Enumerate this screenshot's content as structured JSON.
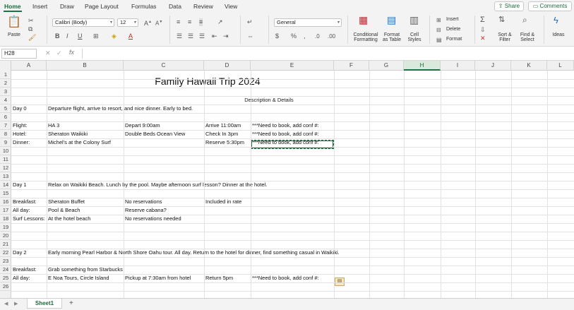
{
  "tabs": [
    "Home",
    "Insert",
    "Draw",
    "Page Layout",
    "Formulas",
    "Data",
    "Review",
    "View"
  ],
  "share_label": "Share",
  "comments_label": "Comments",
  "ribbon": {
    "paste": "Paste",
    "font_name": "Calibri (Body)",
    "font_size": "12",
    "number_format": "General",
    "conditional_formatting": [
      "Conditional",
      "Formatting"
    ],
    "format_as_table": [
      "Format",
      "as Table"
    ],
    "cell_styles": [
      "Cell",
      "Styles"
    ],
    "insert": "Insert",
    "delete": "Delete",
    "format": "Format",
    "sort_filter": [
      "Sort &",
      "Filter"
    ],
    "find_select": [
      "Find &",
      "Select"
    ],
    "ideas": "Ideas"
  },
  "formula_bar": {
    "name_box": "H28",
    "fx": "fx"
  },
  "columns": [
    "A",
    "B",
    "C",
    "D",
    "E",
    "F",
    "G",
    "H",
    "I",
    "J",
    "K",
    "L"
  ],
  "selected_column": "H",
  "rows": [
    "1",
    "2",
    "3",
    "4",
    "5",
    "6",
    "7",
    "8",
    "9",
    "10",
    "11",
    "12",
    "13",
    "14",
    "15",
    "16",
    "17",
    "18",
    "19",
    "20",
    "21",
    "22",
    "23",
    "24",
    "25",
    "26"
  ],
  "sheet": {
    "title": "Family Hawaii Trip 2024",
    "desc_header": "Description & Details",
    "r5": {
      "a": "Day 0",
      "b": "Departure flight, arrive to resort, and nice dinner. Early to bed."
    },
    "r7": {
      "a": "Flight:",
      "b": "HA 3",
      "c": "Depart 9:00am",
      "d": "Arrive 11:00am",
      "e": "***Need to book, add conf #:"
    },
    "r8": {
      "a": "Hotel:",
      "b": "Sheraton Waikiki",
      "c": "Double Beds Ocean View",
      "d": "Check In 3pm",
      "e": "***Need to book, add conf #:"
    },
    "r9": {
      "a": "Dinner:",
      "b": "Michel's at the Colony Surf",
      "d": "Reserve 5:30pm",
      "e": "***Need to book, add conf #:"
    },
    "r14": {
      "a": "Day 1",
      "b": "Relax on Waikiki Beach. Lunch by the pool. Maybe afternoon surf lesson? Dinner at the hotel."
    },
    "r16": {
      "a": "Breakfast:",
      "b": "Sheraton Buffet",
      "c": "No reservations",
      "d": "Included in rate"
    },
    "r17": {
      "a": "All day:",
      "b": "Pool & Beach",
      "c": "Reserve cabana?"
    },
    "r18": {
      "a": "Surf Lessons:",
      "b": "At the hotel beach",
      "c": "No reservations needed"
    },
    "r22": {
      "a": "Day 2",
      "b": "Early morning Pearl Harbor & North Shore Oahu tour. All day. Return to the hotel for dinner, find something casual in Waikiki."
    },
    "r24": {
      "a": "Breakfast:",
      "b": "Grab something from Starbucks"
    },
    "r25": {
      "a": "All day:",
      "b": "E Noa Tours, Circle Island",
      "c": "Pickup at 7:30am from hotel",
      "d": "Return 5pm",
      "e": "***Need to book, add conf #:"
    }
  },
  "sheet_tab": "Sheet1",
  "add_sheet": "+"
}
